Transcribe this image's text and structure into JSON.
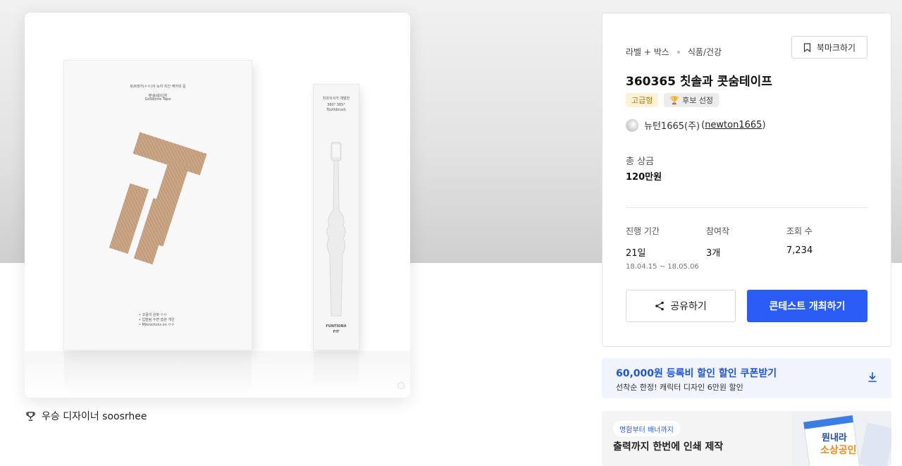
{
  "product_image": {
    "box_text_lines": [
      "포르테가(ㅇㅇ)의 녹아 치간 케어의 길",
      "콧숨테이프",
      "Godsome Tape"
    ],
    "box_bullets": [
      "• 코골이 완화 ㅇㅇ",
      "• 입벌림 수면 습관 개선",
      "• Mikroclicks on ㅇㅇ"
    ],
    "brush_box_lines": [
      "치과의사가 개발한",
      "360° 365°",
      "Toothbrush"
    ],
    "brush_box_brand": [
      "FUNTIONA",
      "FIT"
    ]
  },
  "winner": {
    "label": "우승 디자이너 soosrhee"
  },
  "info": {
    "category_main": "라벨 + 박스",
    "category_sub": "식품/건강",
    "bookmark_label": "북마크하기",
    "title": "360365 칫솔과 콧숨테이프",
    "badge_grade": "고급형",
    "badge_candidate": "후보 선정",
    "holder_name": "뉴턴1665(주)",
    "holder_handle_open": "(",
    "holder_handle": "newton1665",
    "holder_handle_close": ")",
    "prize_label": "총 상금",
    "prize_value": "120만원",
    "stats": {
      "period_label": "진행 기간",
      "period_value": "21일",
      "period_dates": "18.04.15 ~ 18.05.06",
      "entries_label": "참여작",
      "entries_value": "3개",
      "views_label": "조회 수",
      "views_value": "7,234"
    },
    "share_label": "공유하기",
    "host_label": "콘테스트 개최하기"
  },
  "coupon": {
    "title": "60,000원 등록비 할인 할인 쿠폰받기",
    "subtitle": "선착순 한정! 캐릭터 디자인 6만원 할인"
  },
  "print_ad": {
    "chip": "명함부터 배너까지",
    "title": "출력까지 한번에 인쇄 제작",
    "art_text_line1": "뭔내라",
    "art_text_line2": "소상공인"
  },
  "colors": {
    "primary": "#2a5df5",
    "coupon_bg": "#f0f5fd",
    "coupon_text": "#1f55d8",
    "grade_badge_bg": "#fdf1d6",
    "tape": "#c8a17f"
  }
}
